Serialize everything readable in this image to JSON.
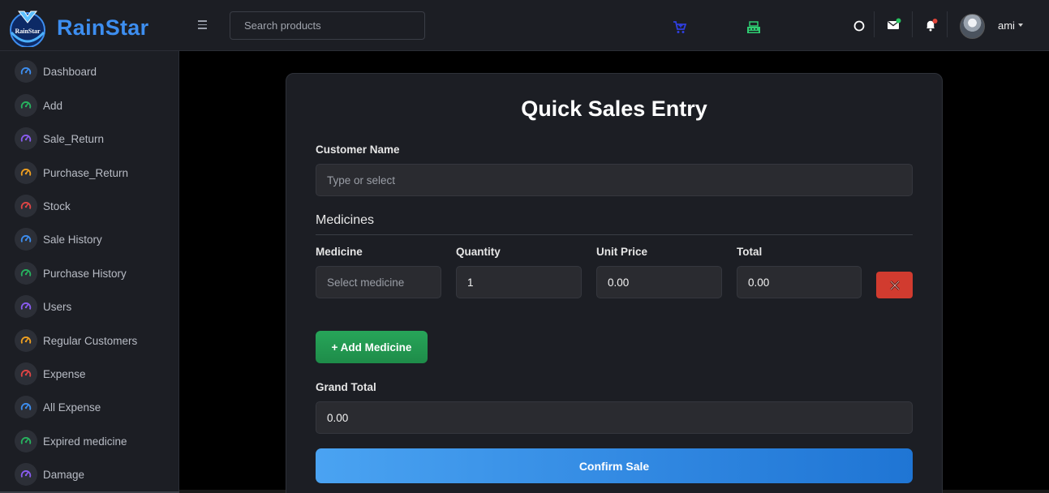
{
  "brand": {
    "name": "RainStar",
    "logo_text": "RainStar"
  },
  "header": {
    "search_placeholder": "Search products",
    "user_name": "ami"
  },
  "sidebar": {
    "items": [
      {
        "label": "Dashboard",
        "icon": "gauge-icon",
        "color": "#3d8ef0"
      },
      {
        "label": "Add",
        "icon": "gauge-icon",
        "color": "#27b35f"
      },
      {
        "label": "Sale_Return",
        "icon": "gauge-icon",
        "color": "#8a5cf0"
      },
      {
        "label": "Purchase_Return",
        "icon": "gauge-icon",
        "color": "#f0a020"
      },
      {
        "label": "Stock",
        "icon": "gauge-icon",
        "color": "#e04545"
      },
      {
        "label": "Sale History",
        "icon": "gauge-icon",
        "color": "#3d8ef0"
      },
      {
        "label": "Purchase History",
        "icon": "gauge-icon",
        "color": "#27b35f"
      },
      {
        "label": "Users",
        "icon": "gauge-icon",
        "color": "#8a5cf0"
      },
      {
        "label": "Regular Customers",
        "icon": "gauge-icon",
        "color": "#f0a020"
      },
      {
        "label": "Expense",
        "icon": "gauge-icon",
        "color": "#e04545"
      },
      {
        "label": "All Expense",
        "icon": "gauge-icon",
        "color": "#3d8ef0"
      },
      {
        "label": "Expired medicine",
        "icon": "gauge-icon",
        "color": "#27b35f"
      },
      {
        "label": "Damage",
        "icon": "gauge-icon",
        "color": "#8a5cf0"
      }
    ]
  },
  "form": {
    "title": "Quick Sales Entry",
    "customer_label": "Customer Name",
    "customer_placeholder": "Type or select",
    "medicines_heading": "Medicines",
    "columns": {
      "medicine": "Medicine",
      "quantity": "Quantity",
      "unit_price": "Unit Price",
      "total": "Total"
    },
    "row": {
      "medicine_placeholder": "Select medicine",
      "quantity": "1",
      "unit_price": "0.00",
      "total": "0.00"
    },
    "add_button": "+ Add Medicine",
    "grand_total_label": "Grand Total",
    "grand_total": "0.00",
    "confirm_button": "Confirm Sale"
  },
  "colors": {
    "brand": "#3d8ef0",
    "add_button": "#27a559",
    "remove_button": "#d13b2f",
    "confirm_button": "#2f86e0",
    "cart_icon": "#2f3fe0",
    "register_icon": "#2ecc71",
    "mail_badge": "#27c25f",
    "bell_badge": "#e0453a"
  }
}
